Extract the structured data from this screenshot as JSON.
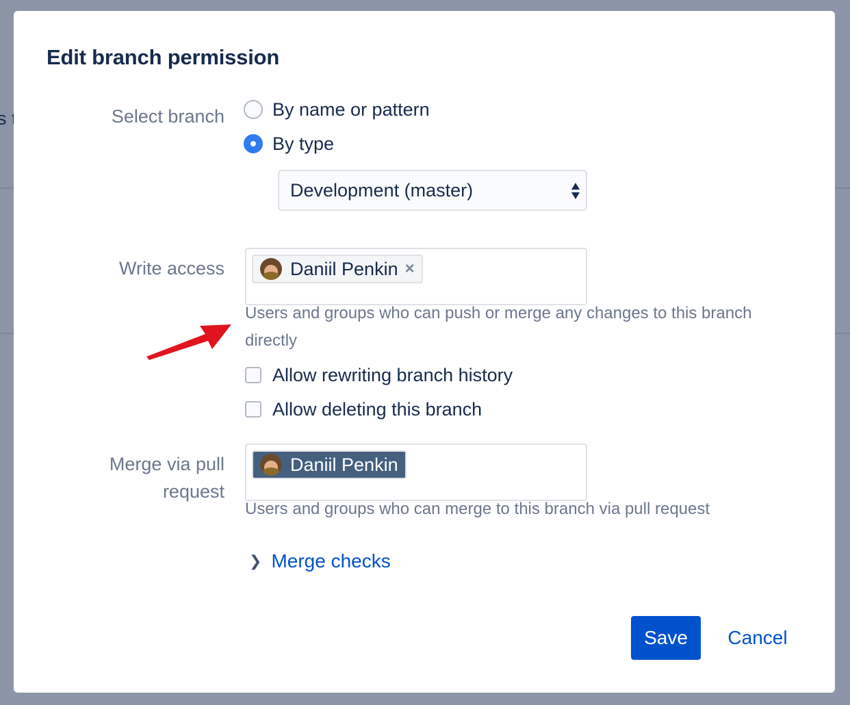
{
  "background": {
    "partial_text": "s t"
  },
  "dialog": {
    "title": "Edit branch permission",
    "select_branch": {
      "label": "Select branch",
      "options": [
        {
          "label": "By name or pattern",
          "checked": false
        },
        {
          "label": "By type",
          "checked": true
        }
      ],
      "type_select_value": "Development (master)"
    },
    "write_access": {
      "label": "Write access",
      "tag": "Daniil Penkin",
      "tag_remove": "×",
      "help": "Users and groups who can push or merge any changes to this branch directly"
    },
    "checkboxes": [
      {
        "label": "Allow rewriting branch history",
        "checked": false
      },
      {
        "label": "Allow deleting this branch",
        "checked": false
      }
    ],
    "merge_pr": {
      "label": "Merge via pull request",
      "tag": "Daniil Penkin",
      "help": "Users and groups who can merge to this branch via pull request"
    },
    "merge_checks": {
      "label": "Merge checks",
      "icon": "chevron-right-icon"
    },
    "buttons": {
      "save": "Save",
      "cancel": "Cancel"
    }
  },
  "colors": {
    "primary": "#0052cc",
    "radio_checked": "#2f7cef",
    "annotation_arrow": "#e0141c",
    "overlay": "#8b95a7"
  }
}
